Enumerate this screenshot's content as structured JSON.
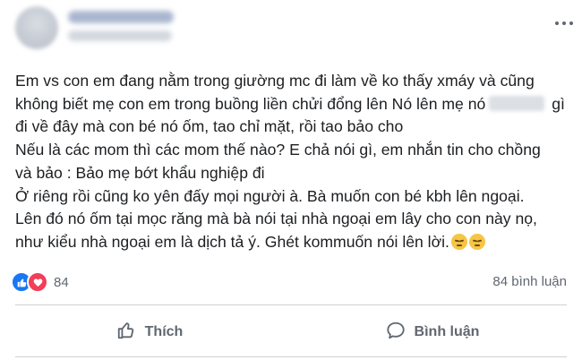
{
  "post": {
    "author_name": "",
    "lines": [
      "Em vs con em đang nằm trong giường mc đi làm về ko thấy xmáy và cũng",
      "không biết mẹ con em trong buồng liền chửi đổng lên Nó lên mẹ nó",
      "gì",
      "đi về đây mà con bé nó ốm, tao chỉ mặt, rồi tao bảo cho",
      "Nếu là các mom thì các mom thế nào? E chả nói gì, em nhắn tin cho chồng",
      "và bảo : Bảo mẹ bớt khẩu nghiệp đi",
      "Ở riêng rồi cũng ko yên đấy mọi người à. Bà muốn con bé kbh lên ngoại.",
      "Lên đó nó ốm tại mọc răng mà bà nói tại nhà ngoại em lây cho con này nọ,",
      "như kiểu nhà ngoại em là dịch tả ý. Ghét kommuốn nói lên lời."
    ],
    "emojis": [
      "pensive-face",
      "pensive-face"
    ]
  },
  "reactions": {
    "count": "84",
    "icons": [
      "like",
      "love"
    ]
  },
  "comments": {
    "count_label": "84 bình luận"
  },
  "actions": {
    "like_label": "Thích",
    "comment_label": "Bình luận"
  },
  "colors": {
    "like_blue": "#1877f2",
    "love_red": "#f33e58",
    "secondary_text": "#606770",
    "divider": "#ced0d4"
  }
}
